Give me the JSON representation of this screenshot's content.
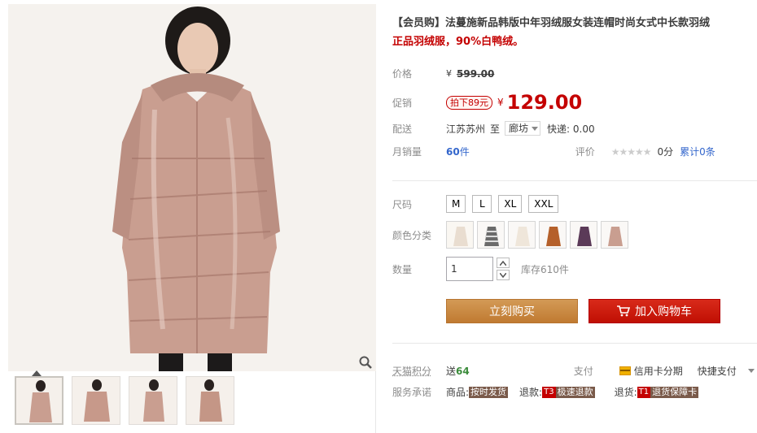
{
  "product": {
    "title": "【会员购】法蔓施新品韩版中年羽绒服女装连帽时尚女式中长款羽绒",
    "subtitle": "正品羽绒服，90%白鸭绒。"
  },
  "price": {
    "label": "价格",
    "currency": "¥",
    "original": "599.00"
  },
  "promo": {
    "label": "促销",
    "tag": "拍下89元",
    "currency": "¥",
    "price": "129.00"
  },
  "shipping": {
    "label": "配送",
    "from": "江苏苏州",
    "to_word": "至",
    "destination": "廊坊",
    "express": "快递: 0.00"
  },
  "sales": {
    "label": "月销量",
    "count": "60",
    "unit": "件",
    "rating_label": "评价",
    "stars": "★★★★★",
    "score": "0分",
    "total_reviews": "累计0条"
  },
  "size": {
    "label": "尺码",
    "options": [
      "M",
      "L",
      "XL",
      "XXL"
    ]
  },
  "color": {
    "label": "颜色分类"
  },
  "quantity": {
    "label": "数量",
    "value": "1",
    "stock": "库存610件"
  },
  "actions": {
    "buy_now": "立刻购买",
    "add_to_cart": "加入购物车"
  },
  "points": {
    "label": "天猫积分",
    "send": "送",
    "value": "64",
    "pay_label": "支付",
    "credit": "信用卡分期",
    "quick_pay": "快捷支付"
  },
  "service": {
    "label": "服务承诺",
    "goods": "商品:",
    "goods_tag": "按时发货",
    "refund": "退款:",
    "refund_prefix": "T3",
    "refund_tag": "极速退款",
    "return": "退货:",
    "return_prefix": "T1",
    "return_tag": "退货保障卡"
  },
  "colors": {
    "accent_red": "#c40000",
    "buy_button": "#c9873f",
    "cart_button": "#c8140a"
  }
}
